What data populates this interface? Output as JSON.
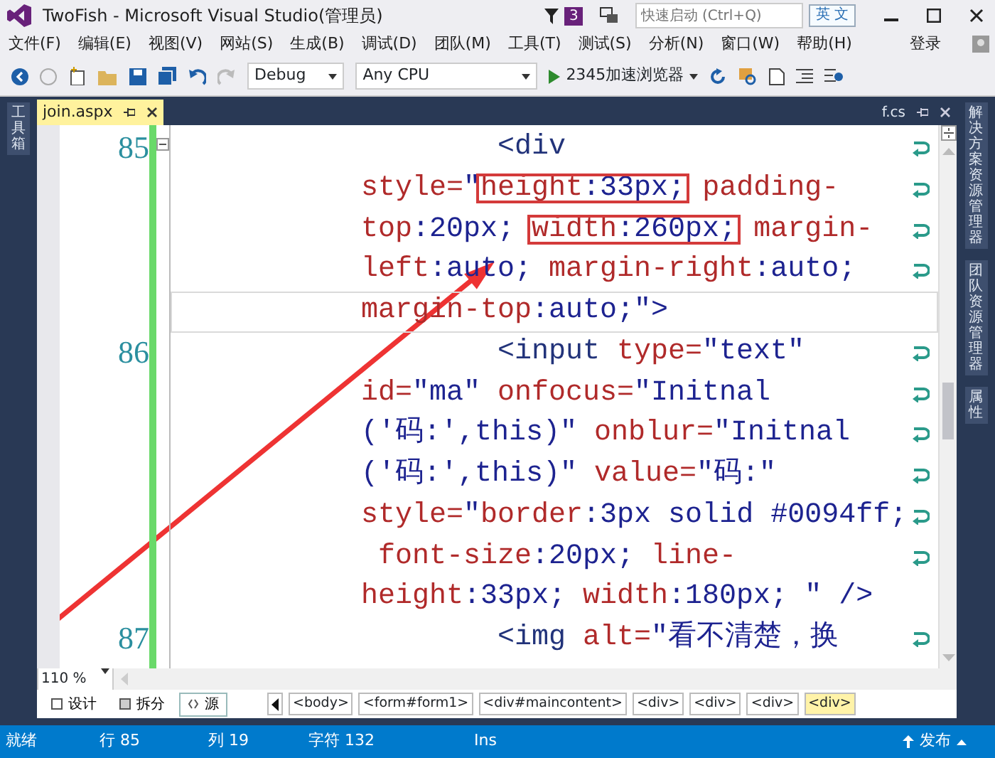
{
  "window": {
    "title": "TwoFish - Microsoft Visual Studio(管理员)",
    "notification_count": "3",
    "quick_launch": {
      "placeholder": "快速启动 (Ctrl+Q)"
    },
    "ime_indicator": "英 文"
  },
  "menu": {
    "items": [
      "文件(F)",
      "编辑(E)",
      "视图(V)",
      "网站(S)",
      "生成(B)",
      "调试(D)",
      "团队(M)",
      "工具(T)",
      "测试(S)",
      "分析(N)",
      "窗口(W)",
      "帮助(H)"
    ],
    "sign_in": "登录"
  },
  "toolbar": {
    "configuration": "Debug",
    "platform": "Any CPU",
    "run_target": "2345加速浏览器"
  },
  "left_panel_tabs": [
    "工具箱"
  ],
  "document_tabs": [
    {
      "label": "join.aspx",
      "selected": true
    },
    {
      "label": "f.cs",
      "selected": false
    }
  ],
  "editor": {
    "lines": [
      {
        "number": "85",
        "wrapped": true,
        "current": false,
        "segments": [
          {
            "text": "        <div",
            "kind": "tag"
          }
        ]
      },
      {
        "wrapped": true,
        "current": false,
        "segments": [
          {
            "text": "style=",
            "kind": "attr"
          },
          {
            "text": "\"",
            "kind": "value"
          },
          {
            "text": "height",
            "kind": "attr",
            "boxed": true
          },
          {
            "text": ":33px;",
            "kind": "value",
            "boxed": true
          },
          {
            "text": " padding-",
            "kind": "attr"
          }
        ]
      },
      {
        "wrapped": true,
        "current": false,
        "segments": [
          {
            "text": "top",
            "kind": "attr"
          },
          {
            "text": ":20px; ",
            "kind": "value"
          },
          {
            "text": "width",
            "kind": "attr",
            "boxed": true
          },
          {
            "text": ":260px;",
            "kind": "value",
            "boxed": true
          },
          {
            "text": " margin-",
            "kind": "attr"
          }
        ]
      },
      {
        "wrapped": true,
        "current": false,
        "segments": [
          {
            "text": "left",
            "kind": "attr"
          },
          {
            "text": ":auto; ",
            "kind": "value"
          },
          {
            "text": "margin-right",
            "kind": "attr"
          },
          {
            "text": ":auto;",
            "kind": "value"
          }
        ]
      },
      {
        "wrapped": false,
        "current": true,
        "segments": [
          {
            "text": "margin-top",
            "kind": "attr"
          },
          {
            "text": ":auto;\">",
            "kind": "value"
          }
        ]
      },
      {
        "number": "86",
        "wrapped": true,
        "current": false,
        "segments": [
          {
            "text": "        <input ",
            "kind": "tag"
          },
          {
            "text": "type=",
            "kind": "attr"
          },
          {
            "text": "\"text\"",
            "kind": "value"
          }
        ]
      },
      {
        "wrapped": true,
        "current": false,
        "segments": [
          {
            "text": "id=",
            "kind": "attr"
          },
          {
            "text": "\"ma\" ",
            "kind": "value"
          },
          {
            "text": "onfocus=",
            "kind": "attr"
          },
          {
            "text": "\"Initnal",
            "kind": "value"
          }
        ]
      },
      {
        "wrapped": true,
        "current": false,
        "segments": [
          {
            "text": "('码:',this)\" ",
            "kind": "value"
          },
          {
            "text": "onblur=",
            "kind": "attr"
          },
          {
            "text": "\"Initnal",
            "kind": "value"
          }
        ]
      },
      {
        "wrapped": true,
        "current": false,
        "segments": [
          {
            "text": "('码:',this)\" ",
            "kind": "value"
          },
          {
            "text": "value=",
            "kind": "attr"
          },
          {
            "text": "\"码:\"",
            "kind": "value"
          }
        ]
      },
      {
        "wrapped": true,
        "current": false,
        "segments": [
          {
            "text": "style=",
            "kind": "attr"
          },
          {
            "text": "\"",
            "kind": "value"
          },
          {
            "text": "border",
            "kind": "attr"
          },
          {
            "text": ":3px solid #0094ff;",
            "kind": "value"
          }
        ]
      },
      {
        "wrapped": true,
        "current": false,
        "segments": [
          {
            "text": " font-size",
            "kind": "attr"
          },
          {
            "text": ":20px; ",
            "kind": "value"
          },
          {
            "text": "line-",
            "kind": "attr"
          }
        ]
      },
      {
        "wrapped": false,
        "current": false,
        "segments": [
          {
            "text": "height",
            "kind": "attr"
          },
          {
            "text": ":33px; ",
            "kind": "value"
          },
          {
            "text": "width",
            "kind": "attr"
          },
          {
            "text": ":180px; \" />",
            "kind": "value"
          }
        ]
      },
      {
        "number": "87",
        "wrapped": true,
        "current": false,
        "segments": [
          {
            "text": "        <img ",
            "kind": "tag"
          },
          {
            "text": "alt=",
            "kind": "attr"
          },
          {
            "text": "\"看不清楚，换",
            "kind": "value"
          }
        ]
      }
    ]
  },
  "zoom": "110 %",
  "view_buttons": [
    {
      "label": "设计",
      "selected": false
    },
    {
      "label": "拆分",
      "selected": false
    },
    {
      "label": "源",
      "selected": true
    }
  ],
  "breadcrumbs": [
    {
      "label": "<body>",
      "selected": false
    },
    {
      "label": "<form#form1>",
      "selected": false
    },
    {
      "label": "<div#maincontent>",
      "selected": false
    },
    {
      "label": "<div>",
      "selected": false
    },
    {
      "label": "<div>",
      "selected": false
    },
    {
      "label": "<div>",
      "selected": false
    },
    {
      "label": "<div>",
      "selected": true
    }
  ],
  "right_panel_tabs": [
    "解决方案资源管理器",
    "团队资源管理器",
    "属性"
  ],
  "status_bar": {
    "state": "就绪",
    "line": "行 85",
    "column": "列 19",
    "characters": "字符 132",
    "mode": "Ins",
    "publish": "发布"
  }
}
